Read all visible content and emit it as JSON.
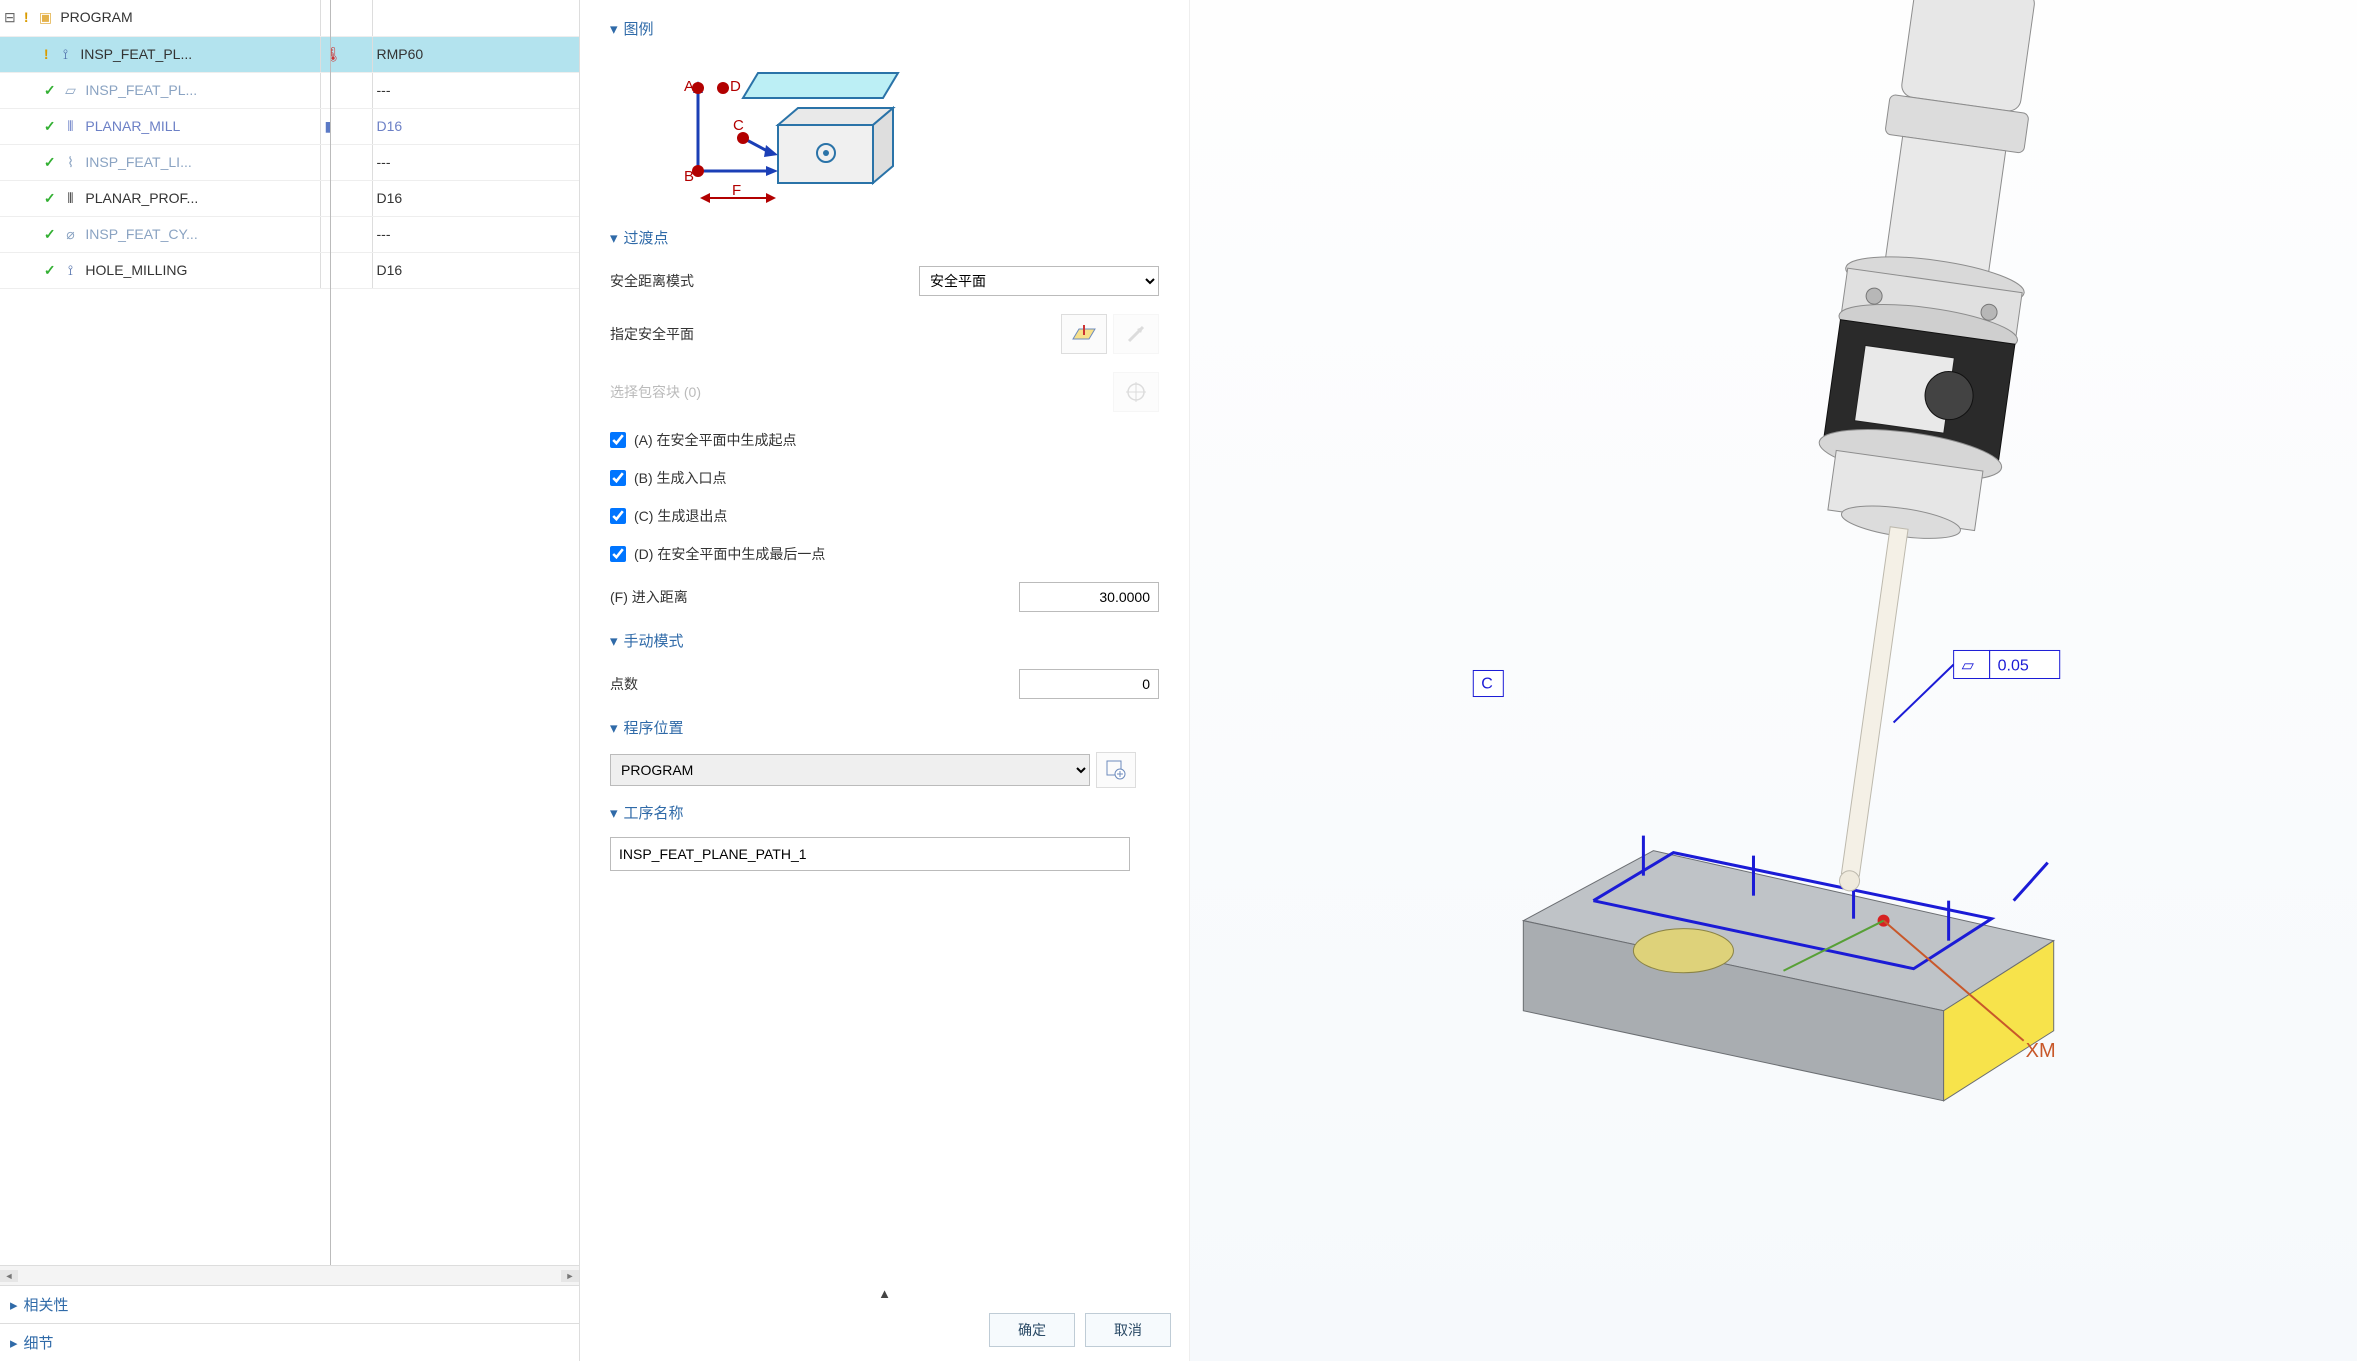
{
  "tree": {
    "root": {
      "label": "PROGRAM"
    },
    "rows": [
      {
        "name": "INSP_FEAT_PL...",
        "tool": "RMP60",
        "status": "warn",
        "icon": "probe-icon",
        "selected": true,
        "faded": false,
        "tool_blue": false,
        "status_icon": "🌡"
      },
      {
        "name": "INSP_FEAT_PL...",
        "tool": "---",
        "status": "check",
        "icon": "square-icon",
        "selected": false,
        "faded": true,
        "tool_blue": false
      },
      {
        "name": "PLANAR_MILL",
        "tool": "D16",
        "status": "check",
        "icon": "mill-icon",
        "selected": false,
        "faded": false,
        "tool_blue": true,
        "status_icon": "▮"
      },
      {
        "name": "INSP_FEAT_LI...",
        "tool": "---",
        "status": "check",
        "icon": "line-icon",
        "selected": false,
        "faded": true,
        "tool_blue": false
      },
      {
        "name": "PLANAR_PROF...",
        "tool": "D16",
        "status": "check",
        "icon": "mill-icon",
        "selected": false,
        "faded": false,
        "tool_blue": false
      },
      {
        "name": "INSP_FEAT_CY...",
        "tool": "---",
        "status": "check",
        "icon": "cyl-icon",
        "selected": false,
        "faded": true,
        "tool_blue": false
      },
      {
        "name": "HOLE_MILLING",
        "tool": "D16",
        "status": "check",
        "icon": "probe-icon",
        "selected": false,
        "faded": false,
        "tool_blue": false
      }
    ],
    "sections": {
      "related": "相关性",
      "detail": "细节"
    }
  },
  "dialog": {
    "legend_title": "图例",
    "legend_labels": {
      "A": "A",
      "B": "B",
      "C": "C",
      "D": "D",
      "F": "F"
    },
    "transition": {
      "title": "过渡点",
      "safe_mode_label": "安全距离模式",
      "safe_mode_value": "安全平面",
      "specify_plane_label": "指定安全平面",
      "select_box_label": "选择包容块 (0)",
      "opt_a": "(A) 在安全平面中生成起点",
      "opt_b": "(B) 生成入口点",
      "opt_c": "(C) 生成退出点",
      "opt_d": "(D) 在安全平面中生成最后一点",
      "approach_label": "(F) 进入距离",
      "approach_value": "30.0000"
    },
    "manual": {
      "title": "手动模式",
      "points_label": "点数",
      "points_value": "0"
    },
    "program": {
      "title": "程序位置",
      "value": "PROGRAM"
    },
    "opname": {
      "title": "工序名称",
      "value": "INSP_FEAT_PLANE_PATH_1"
    },
    "buttons": {
      "ok": "确定",
      "cancel": "取消"
    }
  },
  "view": {
    "axis_label_xm": "XM",
    "axis_label_c": "C",
    "tolerance": "0.05"
  }
}
